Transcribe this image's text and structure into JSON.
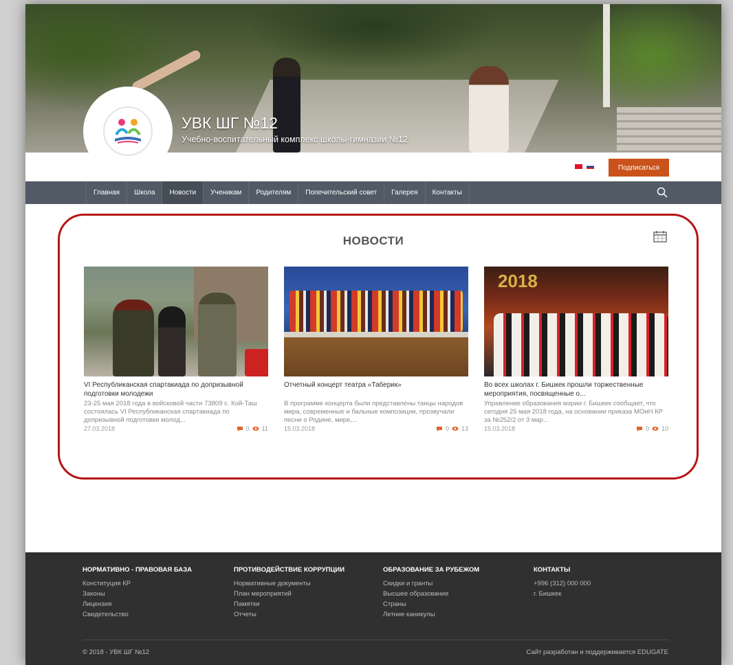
{
  "header": {
    "site_title": "УВК ШГ №12",
    "site_subtitle": "Учебно-воспитательный комплекс школы-гимназии №12",
    "subscribe_label": "Подписаться"
  },
  "nav": {
    "items": [
      {
        "label": "Главная"
      },
      {
        "label": "Школа"
      },
      {
        "label": "Новости"
      },
      {
        "label": "Ученикам"
      },
      {
        "label": "Родителям"
      },
      {
        "label": "Попечительский совет"
      },
      {
        "label": "Галерея"
      },
      {
        "label": "Контакты"
      }
    ],
    "active": "Новости"
  },
  "news": {
    "heading": "НОВОСТИ",
    "cards": [
      {
        "title": "VI Республиканская спартакиада по допризывной подготовки молодежи",
        "excerpt": "23-25 мая 2018 года в войсковой части 73809 с. Кой-Таш состоялась VI Республиканская спартакиада по допризывной подготовки молод...",
        "date": "27.03.2018",
        "comments": "0",
        "views": "11"
      },
      {
        "title": "Отчетный концерт театра «Таберик»",
        "excerpt": "В программе концерта были представлены танцы народов мира, современные и бальные композиции, прозвучали песни о Родине, мире,...",
        "date": "15.03.2018",
        "comments": "0",
        "views": "13"
      },
      {
        "title": "Во всех школах г. Бишкек прошли торжественные мероприятия, посвященные о...",
        "excerpt": "Управление образования мэрии г. Бишкек сообщает, что сегодня 25 мая 2018 года, на основании приказа МОиН КР за №252/2 от 3 мар...",
        "date": "15.03.2018",
        "comments": "0",
        "views": "10",
        "image_text": "2018"
      }
    ]
  },
  "footer": {
    "columns": [
      {
        "heading": "НОРМАТИВНО - ПРАВОВАЯ БАЗА",
        "links": [
          "Конституция КР",
          "Законы",
          "Лицензия",
          "Свидетельство"
        ]
      },
      {
        "heading": "ПРОТИВОДЕЙСТВИЕ КОРРУПЦИИ",
        "links": [
          "Нормативные документы",
          "План мероприятий",
          "Памятки",
          "Отчеты"
        ]
      },
      {
        "heading": "ОБРАЗОВАНИЕ ЗА РУБЕЖОМ",
        "links": [
          "Скидки и гранты",
          "Высшее образование",
          "Страны",
          "Летние каникулы"
        ]
      },
      {
        "heading": "КОНТАКТЫ",
        "links": [
          "+996 (312) 000 000",
          "г. Бишкек"
        ]
      }
    ],
    "copyright": "© 2018 - УВК ШГ №12",
    "developer": "Сайт разработан и поддерживается EDUGATE"
  },
  "colors": {
    "accent": "#c9531a",
    "nav_bg": "#515a65",
    "highlight_frame": "#b51414",
    "footer_bg": "#303030"
  }
}
